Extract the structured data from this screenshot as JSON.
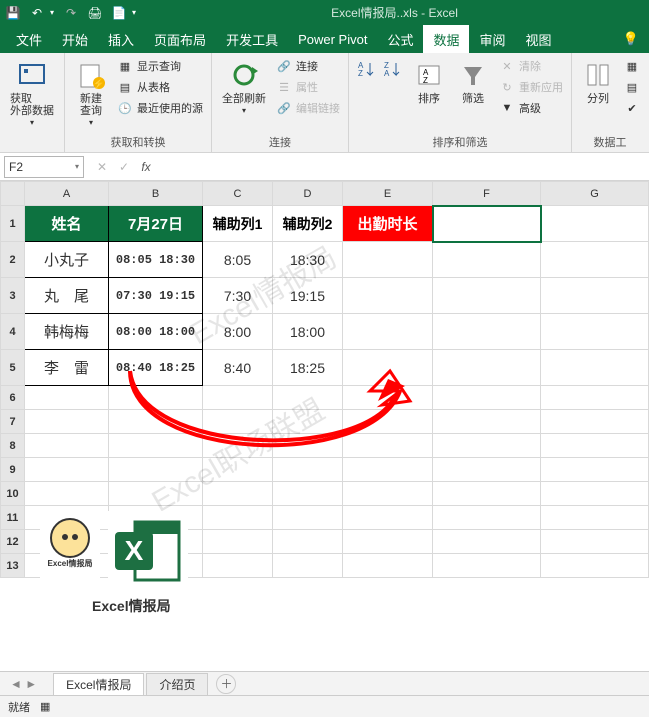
{
  "app": {
    "title": "Excel情报局..xls - Excel"
  },
  "qat": {
    "save": "💾",
    "undo": "↶",
    "redo": "↷",
    "extra1": "🖨",
    "extra2": "📄"
  },
  "tabs": {
    "file": "文件",
    "home": "开始",
    "insert": "插入",
    "layout": "页面布局",
    "dev": "开发工具",
    "powerpivot": "Power Pivot",
    "formula": "公式",
    "data": "数据",
    "review": "审阅",
    "view": "视图"
  },
  "ribbon": {
    "g1": {
      "btn1": "获取\n外部数据",
      "label": ""
    },
    "g2": {
      "btn_newquery": "新建\n查询",
      "opt1": "显示查询",
      "opt2": "从表格",
      "opt3": "最近使用的源",
      "label": "获取和转换"
    },
    "g3": {
      "btn_refresh": "全部刷新",
      "opt1": "连接",
      "opt2": "属性",
      "opt3": "编辑链接",
      "label": "连接"
    },
    "g4": {
      "btn_sort": "排序",
      "btn_filter": "筛选",
      "opt1": "清除",
      "opt2": "重新应用",
      "opt3": "高级",
      "label": "排序和筛选"
    },
    "g5": {
      "btn_split": "分列",
      "label": "数据工"
    }
  },
  "namebox": {
    "ref": "F2"
  },
  "fx": {
    "cancel": "✕",
    "enter": "✓",
    "fx": "fx"
  },
  "colheaders": [
    "A",
    "B",
    "C",
    "D",
    "E",
    "F",
    "G"
  ],
  "rowheaders": [
    "1",
    "2",
    "3",
    "4",
    "5",
    "6",
    "7",
    "8",
    "9",
    "10",
    "11",
    "12",
    "13"
  ],
  "table": {
    "header": {
      "A": "姓名",
      "B": "7月27日",
      "C": "辅助列1",
      "D": "辅助列2",
      "E": "出勤时长"
    },
    "rows": [
      {
        "A": "小丸子",
        "B": "08:05 18:30",
        "C": "8:05",
        "D": "18:30"
      },
      {
        "A": "丸　尾",
        "B": "07:30 19:15",
        "C": "7:30",
        "D": "19:15"
      },
      {
        "A": "韩梅梅",
        "B": "08:00 18:00",
        "C": "8:00",
        "D": "18:00"
      },
      {
        "A": "李　雷",
        "B": "08:40 18:25",
        "C": "8:40",
        "D": "18:25"
      }
    ]
  },
  "watermark1": "Excel情报局",
  "watermark2": "Excel职场联盟",
  "logos": {
    "bee_cap": "Excel情报局",
    "caption": "Excel情报局"
  },
  "sheets": {
    "tab1": "Excel情报局",
    "tab2": "介绍页"
  },
  "status": {
    "ready": "就绪"
  },
  "chart_data": {
    "type": "table",
    "title": "出勤时长",
    "columns": [
      "姓名",
      "7月27日",
      "辅助列1",
      "辅助列2",
      "出勤时长"
    ],
    "rows": [
      [
        "小丸子",
        "08:05 18:30",
        "8:05",
        "18:30",
        ""
      ],
      [
        "丸 尾",
        "07:30 19:15",
        "7:30",
        "19:15",
        ""
      ],
      [
        "韩梅梅",
        "08:00 18:00",
        "8:00",
        "18:00",
        ""
      ],
      [
        "李 雷",
        "08:40 18:25",
        "8:40",
        "18:25",
        ""
      ]
    ]
  }
}
